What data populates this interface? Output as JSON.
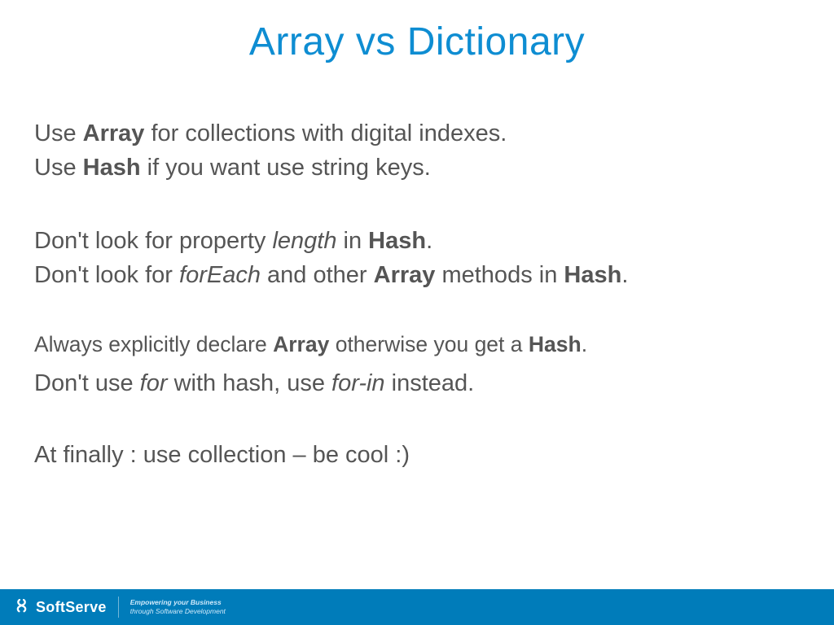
{
  "title": "Array vs Dictionary",
  "p1": {
    "l1_a": "Use ",
    "l1_b": "Array",
    "l1_c": " for collections with digital indexes.",
    "l2_a": "Use ",
    "l2_b": "Hash",
    "l2_c": " if you want use string keys."
  },
  "p2": {
    "l1_a": "Don't look for property ",
    "l1_b": "length",
    "l1_c": " in ",
    "l1_d": "Hash",
    "l1_e": ".",
    "l2_a": "Don't look for ",
    "l2_b": "forEach",
    "l2_c": " and other ",
    "l2_d": "Array",
    "l2_e": " methods in ",
    "l2_f": "Hash",
    "l2_g": "."
  },
  "p3": {
    "l1_a": "Always explicitly declare ",
    "l1_b": "Array",
    "l1_c": " otherwise you get a ",
    "l1_d": "Hash",
    "l1_e": ".",
    "l2_a": "Don't use ",
    "l2_b": "for",
    "l2_c": " with hash, use ",
    "l2_d": "for-in",
    "l2_e": " instead."
  },
  "p4": "At finally : use collection – be cool :)",
  "footer": {
    "brand": "SoftServe",
    "tag1": "Empowering your Business",
    "tag2": "through Software Development"
  }
}
